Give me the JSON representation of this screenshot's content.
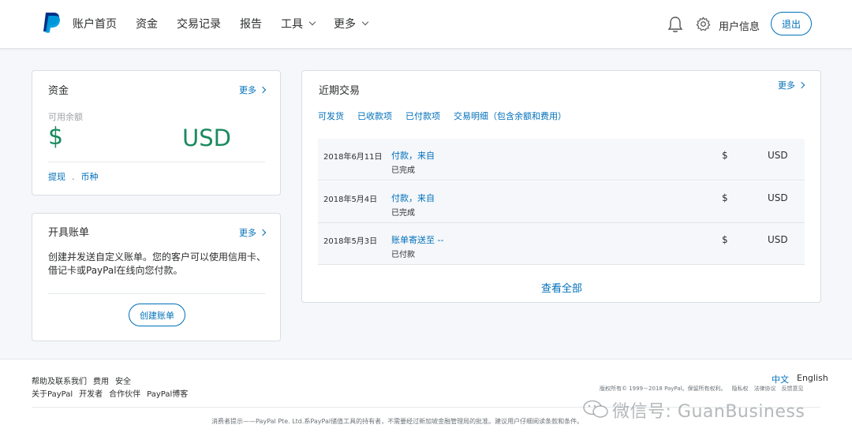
{
  "header": {
    "nav": [
      {
        "label": "账户首页",
        "dropdown": false
      },
      {
        "label": "资金",
        "dropdown": false
      },
      {
        "label": "交易记录",
        "dropdown": false
      },
      {
        "label": "报告",
        "dropdown": false
      },
      {
        "label": "工具",
        "dropdown": true
      },
      {
        "label": "更多",
        "dropdown": true
      }
    ],
    "user_info": "用户信息",
    "logout": "退出",
    "icons": [
      "paypal-logo",
      "bell-icon",
      "gear-icon"
    ]
  },
  "funds": {
    "title": "资金",
    "more": "更多",
    "balance_label": "可用余额",
    "currency_symbol": "$",
    "currency": "USD",
    "links": [
      "提现",
      "币种"
    ]
  },
  "invoice": {
    "title": "开具账单",
    "more": "更多",
    "description": "创建并发送自定义账单。您的客户可以使用信用卡、借记卡或PayPal在线向您付款。",
    "button": "创建账单"
  },
  "transactions": {
    "title": "近期交易",
    "more": "更多",
    "tabs": [
      "可发货",
      "已收款项",
      "已付款项",
      "交易明细（包含余额和费用）"
    ],
    "rows": [
      {
        "date": "2018年6月11日",
        "desc": "付款，来自",
        "status": "已完成",
        "symbol": "$",
        "currency": "USD"
      },
      {
        "date": "2018年5月4日",
        "desc": "付款，来自",
        "status": "已完成",
        "symbol": "$",
        "currency": "USD"
      },
      {
        "date": "2018年5月3日",
        "desc": "账单寄送至 --",
        "status": "已付款",
        "symbol": "$",
        "currency": "USD"
      }
    ],
    "view_all": "查看全部"
  },
  "footer": {
    "links_row1": [
      "帮助及联系我们",
      "费用",
      "安全"
    ],
    "links_row2": [
      "关于PayPal",
      "开发者",
      "合作伙伴",
      "PayPal博客"
    ],
    "languages": [
      "中文",
      "English"
    ],
    "copyright": [
      "版权所有© 1999－2018 PayPal。保留所有权利。",
      "隐私权",
      "法律协议",
      "反馈意见"
    ],
    "disclaimer": "消费者提示——PayPal Pte. Ltd.系PayPal储值工具的持有者，不需要经过新加坡金融管理局的批准。建议用户仔细阅读条款和条件。",
    "watermark": "微信号: GuanBusiness"
  },
  "colors": {
    "brand_blue": "#0070ba",
    "balance_green": "#1a8a5f"
  }
}
